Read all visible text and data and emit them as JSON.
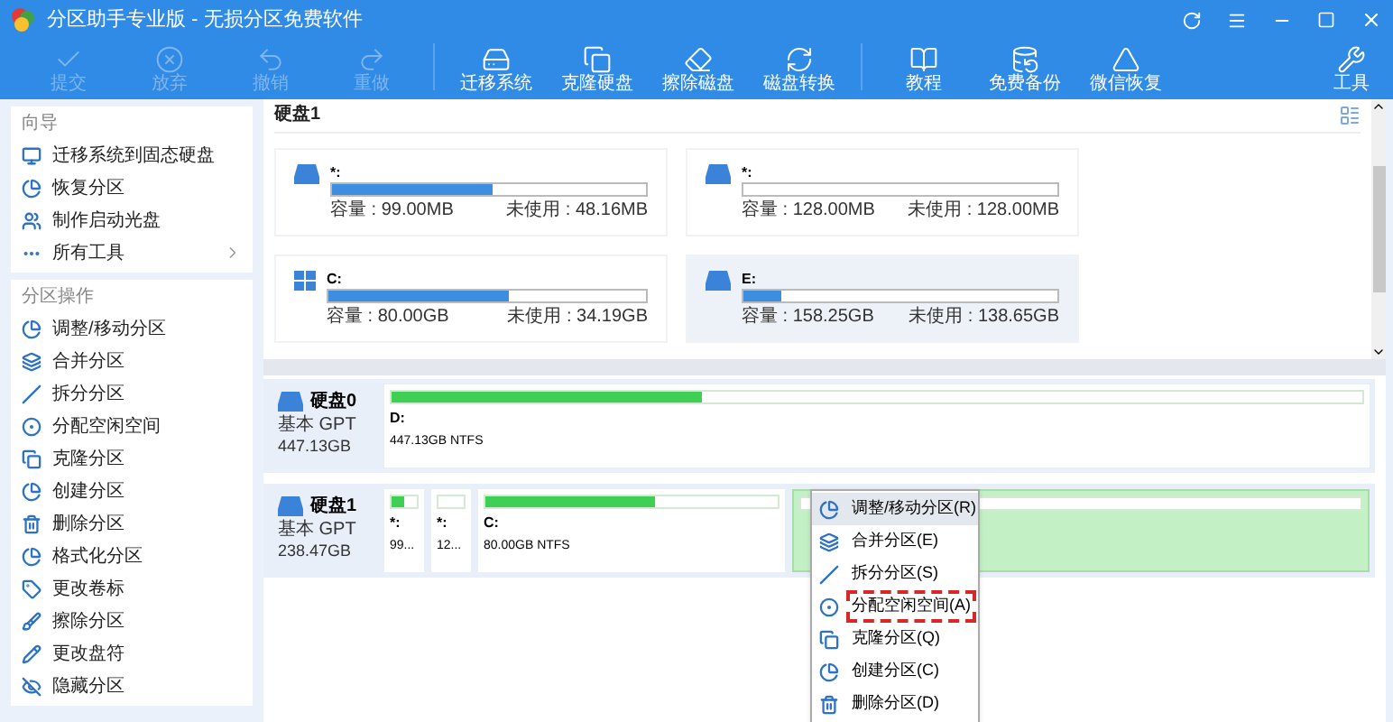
{
  "window": {
    "title": "分区助手专业版 - 无损分区免费软件"
  },
  "toolbar": [
    {
      "label": "提交",
      "disabled": true,
      "kind": "check"
    },
    {
      "label": "放弃",
      "disabled": true,
      "kind": "discard"
    },
    {
      "label": "撤销",
      "disabled": true,
      "kind": "undo"
    },
    {
      "label": "重做",
      "disabled": true,
      "kind": "redo"
    },
    {
      "label": "迁移系统",
      "disabled": false,
      "kind": "migrate"
    },
    {
      "label": "克隆硬盘",
      "disabled": false,
      "kind": "clone"
    },
    {
      "label": "擦除磁盘",
      "disabled": false,
      "kind": "wipe"
    },
    {
      "label": "磁盘转换",
      "disabled": false,
      "kind": "convert"
    },
    {
      "label": "教程",
      "disabled": false,
      "kind": "book"
    },
    {
      "label": "免费备份",
      "disabled": false,
      "kind": "backup"
    },
    {
      "label": "微信恢复",
      "disabled": false,
      "kind": "recover"
    }
  ],
  "tools_button": {
    "label": "工具"
  },
  "sidebar": [
    {
      "title": "向导",
      "items": [
        {
          "label": "迁移系统到固态硬盘",
          "kind": "monitor"
        },
        {
          "label": "恢复分区",
          "kind": "pie"
        },
        {
          "label": "制作启动光盘",
          "kind": "users"
        },
        {
          "label": "所有工具",
          "kind": "more"
        }
      ]
    },
    {
      "title": "分区操作",
      "items": [
        {
          "label": "调整/移动分区",
          "kind": "pie"
        },
        {
          "label": "合并分区",
          "kind": "merge"
        },
        {
          "label": "拆分分区",
          "kind": "split"
        },
        {
          "label": "分配空闲空间",
          "kind": "circle"
        },
        {
          "label": "克隆分区",
          "kind": "copy"
        },
        {
          "label": "创建分区",
          "kind": "pie"
        },
        {
          "label": "删除分区",
          "kind": "trash"
        },
        {
          "label": "格式化分区",
          "kind": "pie"
        },
        {
          "label": "更改卷标",
          "kind": "tag"
        },
        {
          "label": "擦除分区",
          "kind": "brush"
        },
        {
          "label": "更改盘符",
          "kind": "pencil"
        },
        {
          "label": "隐藏分区",
          "kind": "eye"
        }
      ]
    }
  ],
  "top_pane": {
    "title": "硬盘1",
    "cards": [
      {
        "name": "*:",
        "kind": "drive",
        "level": 0.51,
        "capacity": "容量 : 99.00MB",
        "free": "未使用 : 48.16MB",
        "selected": false
      },
      {
        "name": "*:",
        "kind": "drive",
        "capacity": "容量 : 128.00MB",
        "free": "未使用 : 128.00MB",
        "selected": false
      },
      {
        "name": "C:",
        "kind": "windows",
        "level": 0.57,
        "capacity": "容量 : 80.00GB",
        "free": "未使用 : 34.19GB",
        "selected": false
      },
      {
        "name": "E:",
        "kind": "drive",
        "level": 0.12,
        "capacity": "容量 : 158.25GB",
        "free": "未使用 : 138.65GB",
        "selected": true
      }
    ]
  },
  "disks": [
    {
      "name": "硬盘0",
      "type": "基本 GPT",
      "size": "447.13GB",
      "partitions": [
        {
          "name": "D:",
          "info": "447.13GB NTFS",
          "level": 0.32,
          "selected": false,
          "grow": true
        }
      ]
    },
    {
      "name": "硬盘1",
      "type": "基本 GPT",
      "size": "238.47GB",
      "partitions": [
        {
          "name": "*:",
          "info": "99...",
          "level": 0.5,
          "selected": false,
          "grow": false
        },
        {
          "name": "*:",
          "info": "12...",
          "selected": false,
          "grow": false
        },
        {
          "name": "C:",
          "info": "80.00GB NTFS",
          "level": 0.58,
          "selected": false,
          "grow": false
        },
        {
          "selected": true,
          "grow": true
        }
      ]
    }
  ],
  "context_menu": [
    {
      "label": "调整/移动分区(R)",
      "kind": "pie",
      "selected": true,
      "marked": false
    },
    {
      "label": "合并分区(E)",
      "kind": "merge",
      "selected": false,
      "marked": false
    },
    {
      "label": "拆分分区(S)",
      "kind": "split",
      "selected": false,
      "marked": false
    },
    {
      "label": "分配空闲空间(A)",
      "kind": "circle",
      "selected": false,
      "marked": true
    },
    {
      "label": "克隆分区(Q)",
      "kind": "copy",
      "selected": false,
      "marked": false
    },
    {
      "label": "创建分区(C)",
      "kind": "pie",
      "selected": false,
      "marked": false
    },
    {
      "label": "删除分区(D)",
      "kind": "trash",
      "selected": false,
      "marked": false
    }
  ]
}
